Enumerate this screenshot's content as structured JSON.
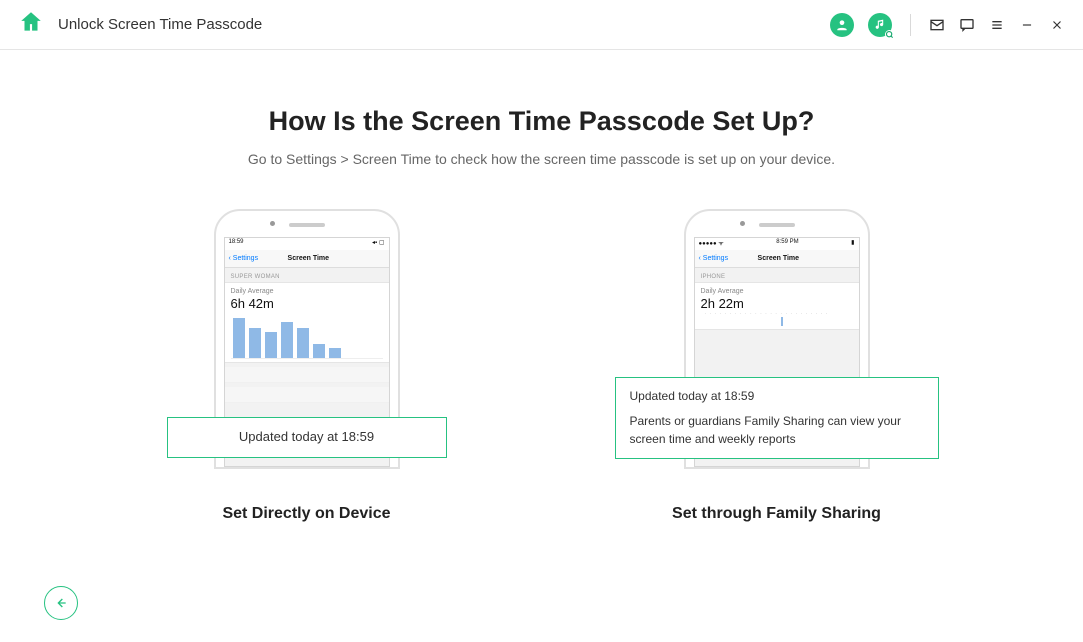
{
  "titlebar": {
    "title": "Unlock Screen Time Passcode"
  },
  "main": {
    "heading": "How Is the Screen Time Passcode Set Up?",
    "subheading": "Go to Settings > Screen Time to check how the screen time passcode is set up on your device."
  },
  "option_left": {
    "title": "Set Directly on Device",
    "badge": "Updated today at 18:59",
    "phone": {
      "time": "18:59",
      "status_right": "◂▪ ▢",
      "back": "Settings",
      "nav_title": "Screen Time",
      "section": "SUPER WOMAN",
      "daily_label": "Daily Average",
      "daily_value": "6h 42m",
      "bars": [
        40,
        30,
        26,
        36,
        30,
        14,
        10
      ]
    }
  },
  "option_right": {
    "title": "Set through Family Sharing",
    "badge_line1": "Updated today at 18:59",
    "badge_line2": "Parents or guardians Family Sharing can view your screen time and weekly reports",
    "phone": {
      "time": "8:59 PM",
      "status_left": "●●●●● ",
      "wifi": "ᯤ",
      "back": "Settings",
      "nav_title": "Screen Time",
      "section": "IPHONE",
      "daily_label": "Daily Average",
      "daily_value": "2h 22m"
    }
  }
}
